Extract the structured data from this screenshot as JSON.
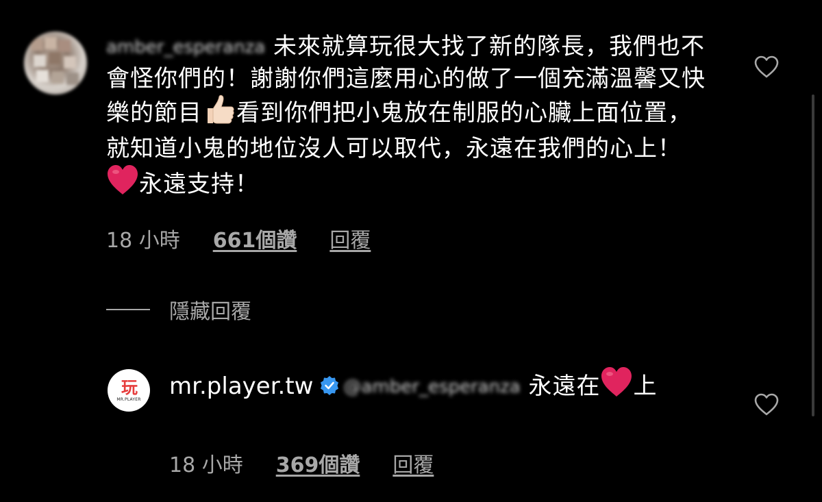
{
  "comments": [
    {
      "username": "amber_esperanza",
      "text_parts": [
        "未來就算玩很大找了新的隊長，我們也不會怪你們的！謝謝你們這麼用心的做了一個充滿溫馨又快樂的節目",
        "看到你們把小鬼放在制服的心臟上面位置，就知道小鬼的地位沒人可以取代，永遠在我們的心上！",
        "永遠支持！"
      ],
      "emojis": [
        "thumbs-up",
        "red-heart"
      ],
      "time": "18 小時",
      "likes": "661個讚",
      "reply_label": "回覆"
    },
    {
      "username": "mr.player.tw",
      "verified": true,
      "mention": "@amber_esperanza",
      "text_parts": [
        "永遠在",
        "上"
      ],
      "emojis": [
        "red-heart"
      ],
      "time": "18 小時",
      "likes": "369個讚",
      "reply_label": "回覆",
      "avatar_logo": "MR.PLAYER"
    }
  ],
  "hide_replies_label": "隱藏回覆",
  "colors": {
    "background": "#000000",
    "text": "#ffffff",
    "secondary": "#a8a8a8",
    "verified": "#3897f0",
    "heart": "#e0245e"
  }
}
